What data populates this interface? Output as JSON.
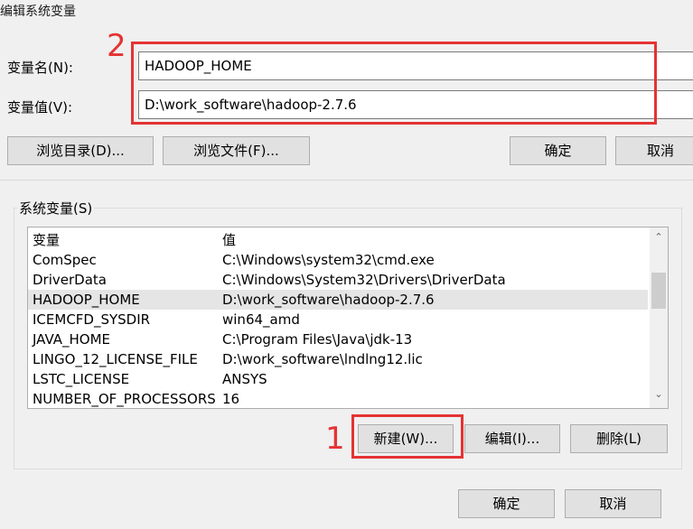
{
  "window": {
    "title": "编辑系统变量"
  },
  "edit": {
    "name_label": "变量名(N):",
    "name_value": "HADOOP_HOME",
    "value_label": "变量值(V):",
    "value_value": "D:\\work_software\\hadoop-2.7.6",
    "browse_dir": "浏览目录(D)...",
    "browse_file": "浏览文件(F)...",
    "ok": "确定",
    "cancel": "取消"
  },
  "system_vars": {
    "group_title": "系统变量(S)",
    "headers": [
      "变量",
      "值"
    ],
    "rows": [
      {
        "name": "ComSpec",
        "value": "C:\\Windows\\system32\\cmd.exe"
      },
      {
        "name": "DriverData",
        "value": "C:\\Windows\\System32\\Drivers\\DriverData"
      },
      {
        "name": "HADOOP_HOME",
        "value": "D:\\work_software\\hadoop-2.7.6"
      },
      {
        "name": "ICEMCFD_SYSDIR",
        "value": "win64_amd"
      },
      {
        "name": "JAVA_HOME",
        "value": "C:\\Program Files\\Java\\jdk-13"
      },
      {
        "name": "LINGO_12_LICENSE_FILE",
        "value": "D:\\work_software\\lndlng12.lic"
      },
      {
        "name": "LSTC_LICENSE",
        "value": "ANSYS"
      },
      {
        "name": "NUMBER_OF_PROCESSORS",
        "value": "16"
      }
    ],
    "selected_row": "HADOOP_HOME",
    "new_button": "新建(W)...",
    "edit_button": "编辑(I)...",
    "delete_button": "删除(L)"
  },
  "footer": {
    "ok": "确定",
    "cancel": "取消"
  },
  "annotations": {
    "label_1": "1",
    "label_2": "2",
    "color": "#e53333"
  },
  "icons": {
    "scroll_up": "chevron-up-icon",
    "scroll_down": "chevron-down-icon"
  }
}
